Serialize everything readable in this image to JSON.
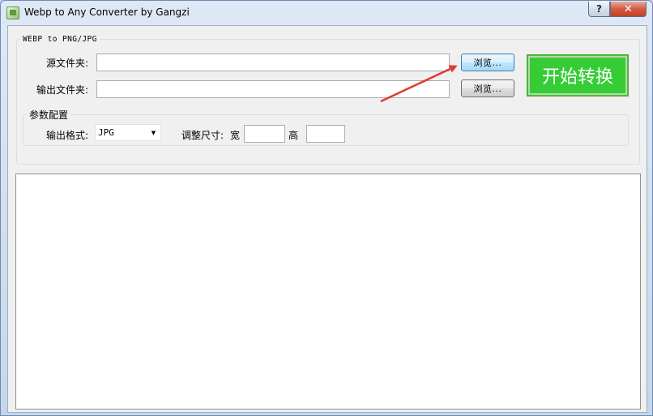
{
  "window": {
    "title": "Webp to Any Converter by Gangzi",
    "help_label": "?",
    "close_label": "✕"
  },
  "main_group": {
    "legend": "WEBP to PNG/JPG"
  },
  "source": {
    "label": "源文件夹:",
    "value": "",
    "browse_label": "浏览..."
  },
  "output": {
    "label": "输出文件夹:",
    "value": "",
    "browse_label": "浏览..."
  },
  "start_button": {
    "label": "开始转换",
    "color": "#36cc36"
  },
  "params": {
    "legend": "参数配置",
    "format_label": "输出格式:",
    "format_value": "JPG",
    "resize_label": "调整尺寸:",
    "width_label": "宽",
    "width_value": "",
    "height_label": "高",
    "height_value": ""
  },
  "log": {
    "content": ""
  },
  "annotation": {
    "arrow_color": "#e03a2f"
  }
}
